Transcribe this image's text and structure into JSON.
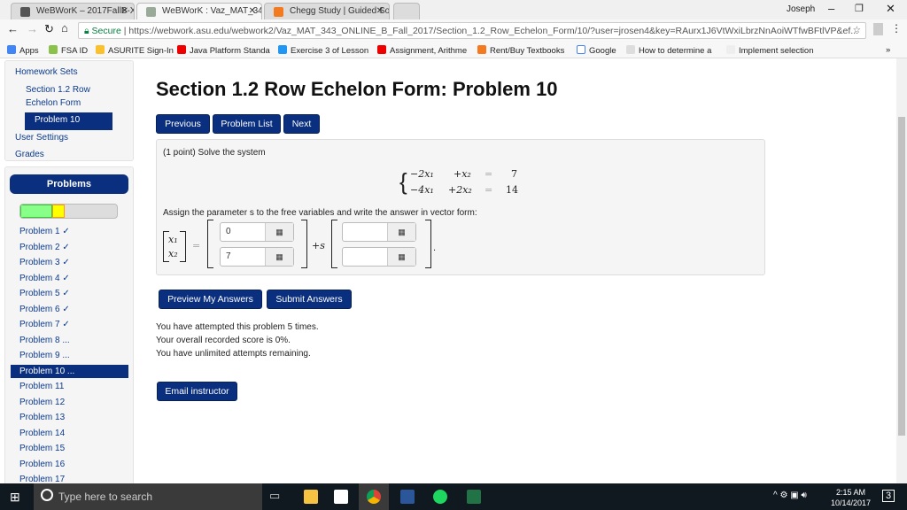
{
  "browser": {
    "tabs": [
      {
        "title": "WeBWorK – 2017FallB-X"
      },
      {
        "title": "WeBWorK : Vaz_MAT_34"
      },
      {
        "title": "Chegg Study | Guided So"
      }
    ],
    "user": "Joseph",
    "url_secure": "Secure",
    "url": "https://webwork.asu.edu/webwork2/Vaz_MAT_343_ONLINE_B_Fall_2017/Section_1.2_Row_Echelon_Form/10/?user=jrosen4&key=RAurx1J6VtWxiLbrzNnAoiWTfwBFtlVP&ef...",
    "bookmarks": [
      "Apps",
      "FSA ID",
      "ASURITE Sign-In",
      "Java Platform Standa",
      "Exercise 3 of Lesson",
      "Assignment, Arithme",
      "Rent/Buy Textbooks",
      "Google",
      "How to determine a",
      "Implement selection"
    ],
    "more": "»"
  },
  "sidebar": {
    "homework_sets": "Homework Sets",
    "section": "Section 1.2 Row",
    "section2": "Echelon Form",
    "current": "Problem 10",
    "user_settings": "User Settings",
    "grades": "Grades",
    "problems_header": "Problems",
    "progress": {
      "correct_fraction": 0.33,
      "partial_fraction": 0.04
    },
    "problems": [
      "Problem 1 ✓",
      "Problem 2 ✓",
      "Problem 3 ✓",
      "Problem 4 ✓",
      "Problem 5 ✓",
      "Problem 6 ✓",
      "Problem 7 ✓",
      "Problem 8 ...",
      "Problem 9 ...",
      "Problem 10 ...",
      "Problem 11",
      "Problem 12",
      "Problem 13",
      "Problem 14",
      "Problem 15",
      "Problem 16",
      "Problem 17"
    ]
  },
  "main": {
    "title": "Section 1.2 Row Echelon Form: Problem 10",
    "nav": {
      "previous": "Previous",
      "list": "Problem List",
      "next": "Next"
    },
    "problem": {
      "intro": "(1 point) Solve the system",
      "eq1": [
        "−2x₁",
        "+x₂",
        "=",
        "7"
      ],
      "eq2": [
        "−4x₁",
        "+2x₂",
        "=",
        "14"
      ],
      "instruction": "Assign the parameter s to the free variables and write the answer in vector form:",
      "lhs": [
        "x₁",
        "x₂"
      ],
      "eq": "=",
      "plus_s": "+s",
      "period": ".",
      "answers": {
        "p1": "0",
        "p2": "7",
        "d1": "",
        "d2": ""
      },
      "grid_icon": "▦"
    },
    "preview": "Preview My Answers",
    "submit": "Submit Answers",
    "messages": [
      "You have attempted this problem 5 times.",
      "Your overall recorded score is 0%.",
      "You have unlimited attempts remaining."
    ],
    "email": "Email instructor"
  },
  "taskbar": {
    "search_placeholder": "Type here to search",
    "time": "2:15 AM",
    "date": "10/14/2017",
    "notifications": "3"
  }
}
